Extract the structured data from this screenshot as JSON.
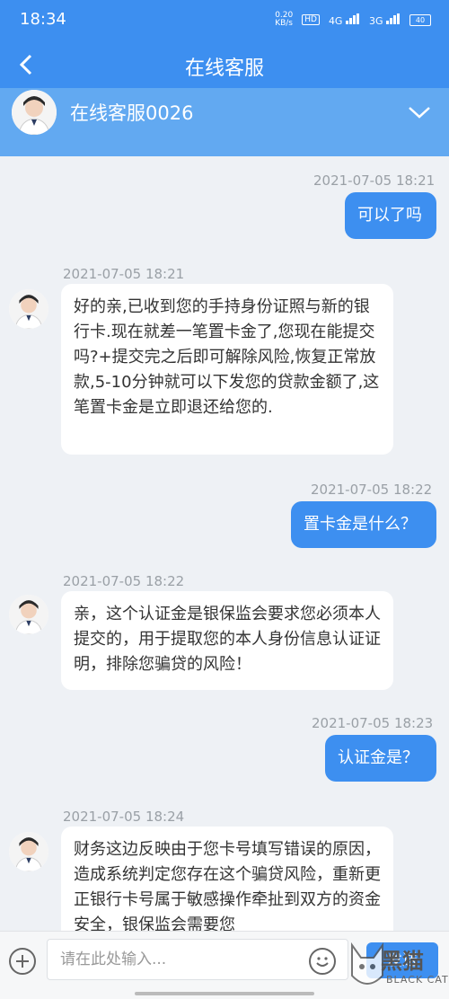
{
  "status": {
    "time": "18:34",
    "speed": "0.20\nKB/s",
    "net1": "4G",
    "net2": "3G",
    "battery": "40",
    "hd": "HD"
  },
  "nav": {
    "title": "在线客服"
  },
  "agent": {
    "name": "在线客服0026"
  },
  "messages": [
    {
      "side": "me",
      "time": "2021-07-05 18:21",
      "text": "可以了吗"
    },
    {
      "side": "them",
      "time": "2021-07-05 18:21",
      "text": "好的亲,已收到您的手持身份证照与新的银行卡.现在就差一笔置卡金了,您现在能提交吗?+提交完之后即可解除风险,恢复正常放款,5-10分钟就可以下发您的贷款金额了,这笔置卡金是立即退还给您的."
    },
    {
      "side": "me",
      "time": "2021-07-05 18:22",
      "text": "置卡金是什么？"
    },
    {
      "side": "them",
      "time": "2021-07-05 18:22",
      "text": "亲，这个认证金是银保监会要求您必须本人提交的，用于提取您的本人身份信息认证证明，排除您骗贷的风险！"
    },
    {
      "side": "me",
      "time": "2021-07-05 18:23",
      "text": "认证金是？"
    },
    {
      "side": "them",
      "time": "2021-07-05 18:24",
      "text": "财务这边反映由于您卡号填写错误的原因，造成系统判定您存在这个骗贷风险，重新更正银行卡号属于敏感操作牵扯到双方的资金安全，银保监会需要您"
    }
  ],
  "input": {
    "placeholder": "请在此处输入...",
    "send": "发送"
  },
  "watermark": {
    "text": "黑猫",
    "sub": "BLACK CAT"
  }
}
